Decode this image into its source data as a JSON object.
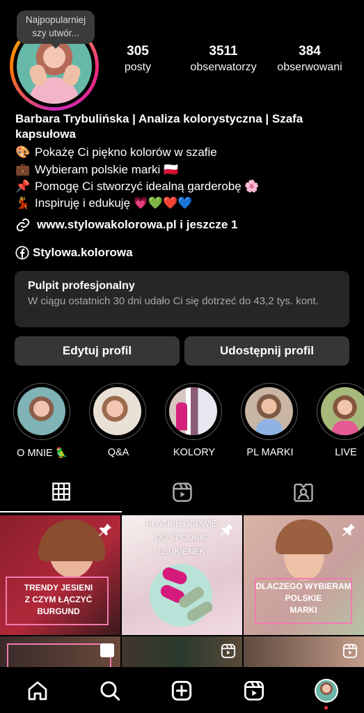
{
  "tooltip": "Najpopularniejszy utwór...",
  "stats": [
    {
      "value": "305",
      "label": "posty"
    },
    {
      "value": "3511",
      "label": "obserwatorzy"
    },
    {
      "value": "384",
      "label": "obserwowani"
    }
  ],
  "profile": {
    "name": "Barbara Trybulińska | Analiza kolorystyczna | Szafa kapsułowa",
    "bio": [
      {
        "emoji": "🎨",
        "text": "Pokażę Ci piękno kolorów w szafie"
      },
      {
        "emoji": "💼",
        "text": "Wybieram polskie marki 🇵🇱"
      },
      {
        "emoji": "📌",
        "text": "Pomogę Ci stworzyć idealną garderobę 🌸"
      },
      {
        "emoji": "💃",
        "text": "Inspiruję i edukuję 💗💚❤️💙"
      }
    ],
    "link": "www.stylowakolorowa.pl i jeszcze 1",
    "facebook": "Stylowa.kolorowa"
  },
  "dashboard": {
    "title": "Pulpit profesjonalny",
    "subtitle": "W ciągu ostatnich 30 dni udało Ci się dotrzeć do 43,2 tys. kont."
  },
  "buttons": {
    "edit": "Edytuj profil",
    "share": "Udostępnij profil"
  },
  "highlights": [
    {
      "label": "O MNIE 🦜"
    },
    {
      "label": "Q&A"
    },
    {
      "label": "KOLORY"
    },
    {
      "label": "PL MARKI"
    },
    {
      "label": "LIVE"
    }
  ],
  "posts": [
    {
      "text": "TRENDY JESIENI\nZ CZYM ŁĄCZYĆ\nBURGUND"
    },
    {
      "text": "PŁASKIE OBUWIE\nDO SPÓDNIC\nI SUKIENEK"
    },
    {
      "text": "DLACZEGO WYBIERAM\nPOLSKIE\nMARKI"
    }
  ],
  "colors": {
    "accent_pink": "#e8157c",
    "panel": "#262626",
    "button": "#363636"
  }
}
